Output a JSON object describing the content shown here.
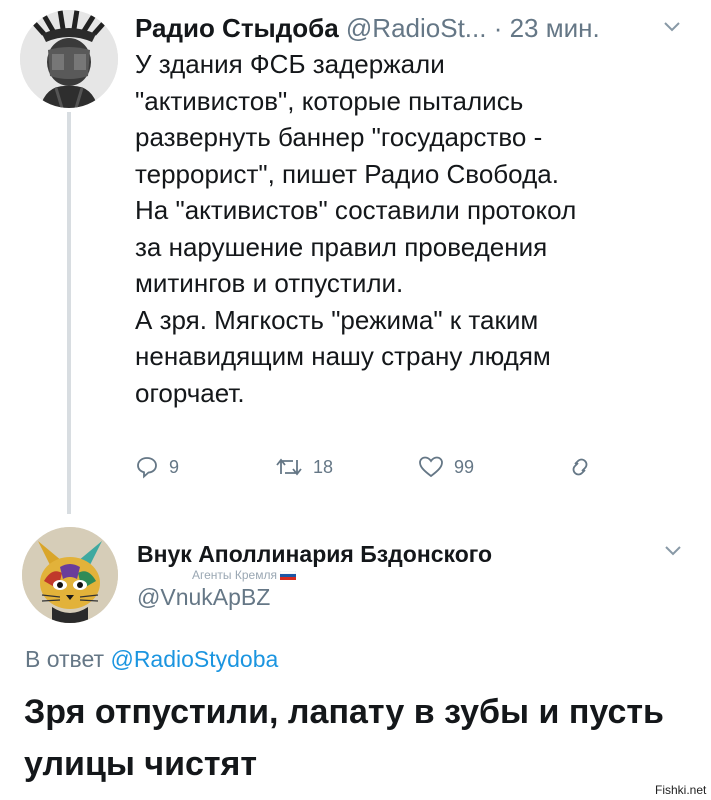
{
  "tweet": {
    "author_name": "Радио Стыдоба",
    "author_handle": "@RadioSt...",
    "time": "· 23 мин.",
    "text_lines": [
      "У здания ФСБ задержали",
      "\"активистов\", которые пытались",
      "развернуть баннер \"государство -",
      "террорист\", пишет Радио Свобода.",
      "На \"активистов\" составили протокол",
      "за нарушение правил проведения",
      "митингов и отпустили.",
      "А зря. Мягкость \"режима\" к таким",
      "ненавидящим нашу страну людям",
      "огорчает."
    ],
    "replies_count": "9",
    "retweets_count": "18",
    "likes_count": "99"
  },
  "reply": {
    "author_name": "Внук Аполлинария Бздонского",
    "badge": "Агенты Кремля",
    "author_handle": "@VnukApBZ",
    "reply_prefix": "В ответ",
    "reply_to_handle": "@RadioStydoba",
    "text": "Зря отпустили, лапату в зубы и пусть улицы чистят"
  },
  "watermark": "Fishki.net",
  "colors": {
    "text": "#14171a",
    "secondary": "#657786",
    "link": "#1b95e0",
    "thread_line": "#d8dde1"
  },
  "icons": [
    "reply-icon",
    "retweet-icon",
    "like-icon",
    "share-icon",
    "chevron-down-icon"
  ]
}
